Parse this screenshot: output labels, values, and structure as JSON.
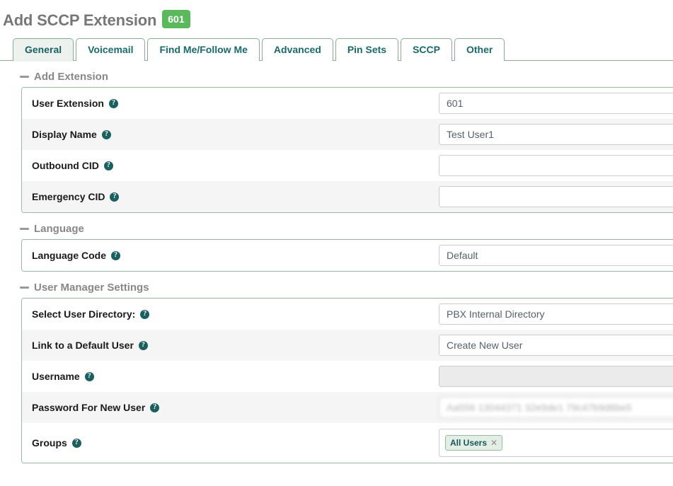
{
  "header": {
    "title": "Add SCCP Extension",
    "extension_badge": "601",
    "badge_color": "#5cb85c"
  },
  "tabs": [
    {
      "label": "General",
      "active": true
    },
    {
      "label": "Voicemail",
      "active": false
    },
    {
      "label": "Find Me/Follow Me",
      "active": false
    },
    {
      "label": "Advanced",
      "active": false
    },
    {
      "label": "Pin Sets",
      "active": false
    },
    {
      "label": "SCCP",
      "active": false
    },
    {
      "label": "Other",
      "active": false
    }
  ],
  "sections": [
    {
      "heading": "Add Extension",
      "rows": [
        {
          "label": "User Extension",
          "value": "601",
          "type": "text",
          "state": "normal"
        },
        {
          "label": "Display Name",
          "value": "Test User1",
          "type": "text",
          "state": "normal"
        },
        {
          "label": "Outbound CID",
          "value": "",
          "type": "text",
          "state": "normal"
        },
        {
          "label": "Emergency CID",
          "value": "",
          "type": "text",
          "state": "normal"
        }
      ]
    },
    {
      "heading": "Language",
      "rows": [
        {
          "label": "Language Code",
          "value": "Default",
          "type": "select",
          "state": "normal"
        }
      ]
    },
    {
      "heading": "User Manager Settings",
      "rows": [
        {
          "label": "Select User Directory:",
          "value": "PBX Internal Directory",
          "type": "select",
          "state": "normal"
        },
        {
          "label": "Link to a Default User",
          "value": "Create New User",
          "type": "select",
          "state": "normal"
        },
        {
          "label": "Username",
          "value": "",
          "type": "text",
          "state": "disabled"
        },
        {
          "label": "Password For New User",
          "value": "Aa556 13044371 32e9de1 79c47b9d6be5",
          "type": "text",
          "state": "blurred"
        },
        {
          "label": "Groups",
          "value": "",
          "type": "tags",
          "state": "normal",
          "tags": [
            "All Users"
          ]
        }
      ]
    }
  ],
  "icons": {
    "help": "?",
    "collapse_dash": "-",
    "tag_remove": "✕"
  }
}
